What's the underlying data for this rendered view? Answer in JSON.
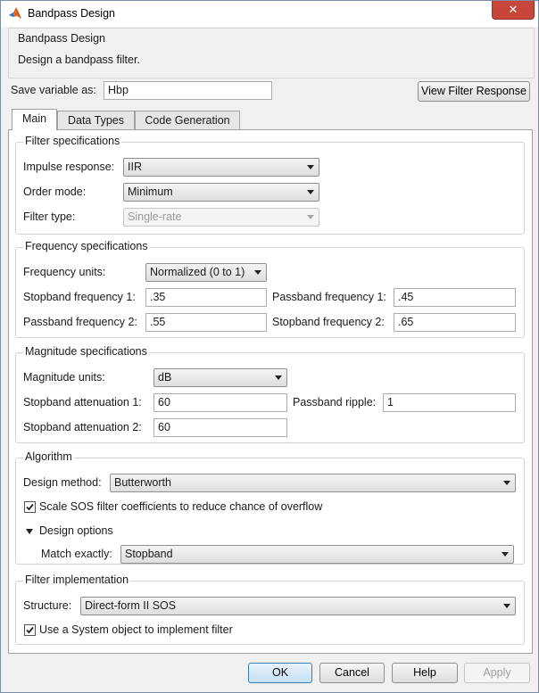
{
  "window": {
    "title": "Bandpass Design",
    "close_glyph": "✕"
  },
  "header": {
    "title": "Bandpass Design",
    "description": "Design a bandpass filter."
  },
  "save_variable": {
    "label": "Save variable as:",
    "value": "Hbp"
  },
  "view_response_button": "View Filter Response",
  "tabs": [
    {
      "label": "Main",
      "active": true
    },
    {
      "label": "Data Types",
      "active": false
    },
    {
      "label": "Code Generation",
      "active": false
    }
  ],
  "filter_spec": {
    "title": "Filter specifications",
    "impulse_label": "Impulse response:",
    "impulse_value": "IIR",
    "order_label": "Order mode:",
    "order_value": "Minimum",
    "type_label": "Filter type:",
    "type_value": "Single-rate"
  },
  "freq_spec": {
    "title": "Frequency specifications",
    "units_label": "Frequency units:",
    "units_value": "Normalized (0 to 1)",
    "stop1_label": "Stopband frequency 1:",
    "stop1_value": ".35",
    "pass1_label": "Passband frequency 1:",
    "pass1_value": ".45",
    "pass2_label": "Passband frequency 2:",
    "pass2_value": ".55",
    "stop2_label": "Stopband frequency 2:",
    "stop2_value": ".65"
  },
  "mag_spec": {
    "title": "Magnitude specifications",
    "units_label": "Magnitude units:",
    "units_value": "dB",
    "att1_label": "Stopband attenuation 1:",
    "att1_value": "60",
    "ripple_label": "Passband ripple:",
    "ripple_value": "1",
    "att2_label": "Stopband attenuation 2:",
    "att2_value": "60"
  },
  "algorithm": {
    "title": "Algorithm",
    "method_label": "Design method:",
    "method_value": "Butterworth",
    "scale_label": "Scale SOS filter coefficients to reduce chance of overflow",
    "scale_checked": true,
    "options_label": "Design options",
    "match_label": "Match exactly:",
    "match_value": "Stopband"
  },
  "implementation": {
    "title": "Filter implementation",
    "structure_label": "Structure:",
    "structure_value": "Direct-form II SOS",
    "sysobj_label": "Use a System object to implement filter",
    "sysobj_checked": true
  },
  "buttons": {
    "ok": "OK",
    "cancel": "Cancel",
    "help": "Help",
    "apply": "Apply"
  },
  "colors": {
    "close": "#c7463c",
    "accent": "#3c7fb1"
  }
}
